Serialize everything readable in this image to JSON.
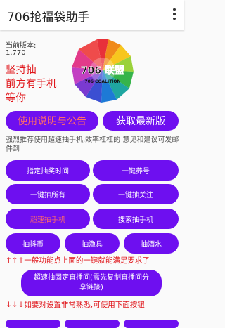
{
  "app": {
    "title": "706抢福袋助手"
  },
  "version": {
    "label": "当前版本:",
    "value": "1.770"
  },
  "slogan": [
    "坚持抽",
    "前方有手机",
    "等你"
  ],
  "logo": {
    "text_main": "706 联盟",
    "text_sub": "706 COALITION"
  },
  "top_buttons": {
    "guide": "使用说明与公告",
    "update": "获取最新版"
  },
  "notice": "强烈推荐使用超速抽手机,效率杠杠的 意见和建议可发邮件到",
  "grid": {
    "schedule": "指定抽奖时间",
    "raise": "一键养号",
    "draw_all": "一键抽所有",
    "draw_follow": "一键抽关注",
    "fast_phone": "超速抽手机",
    "search_phone": "搜索抽手机",
    "coins": "抽抖币",
    "fishing": "抽渔具",
    "wine": "抽酒水"
  },
  "hint_up": "↑↑↑一般功能点上面的一键就能满足要求了",
  "fixed_room": "超速抽固定直播间(需先复制直播间分享链接)",
  "hint_down": "↓↓↓如要对设置非常熟悉,可使用下面按钮",
  "colors": {
    "primary": "#6e0ff0",
    "accent_red": "#e0161b",
    "highlight_text": "#ff6a6a"
  }
}
